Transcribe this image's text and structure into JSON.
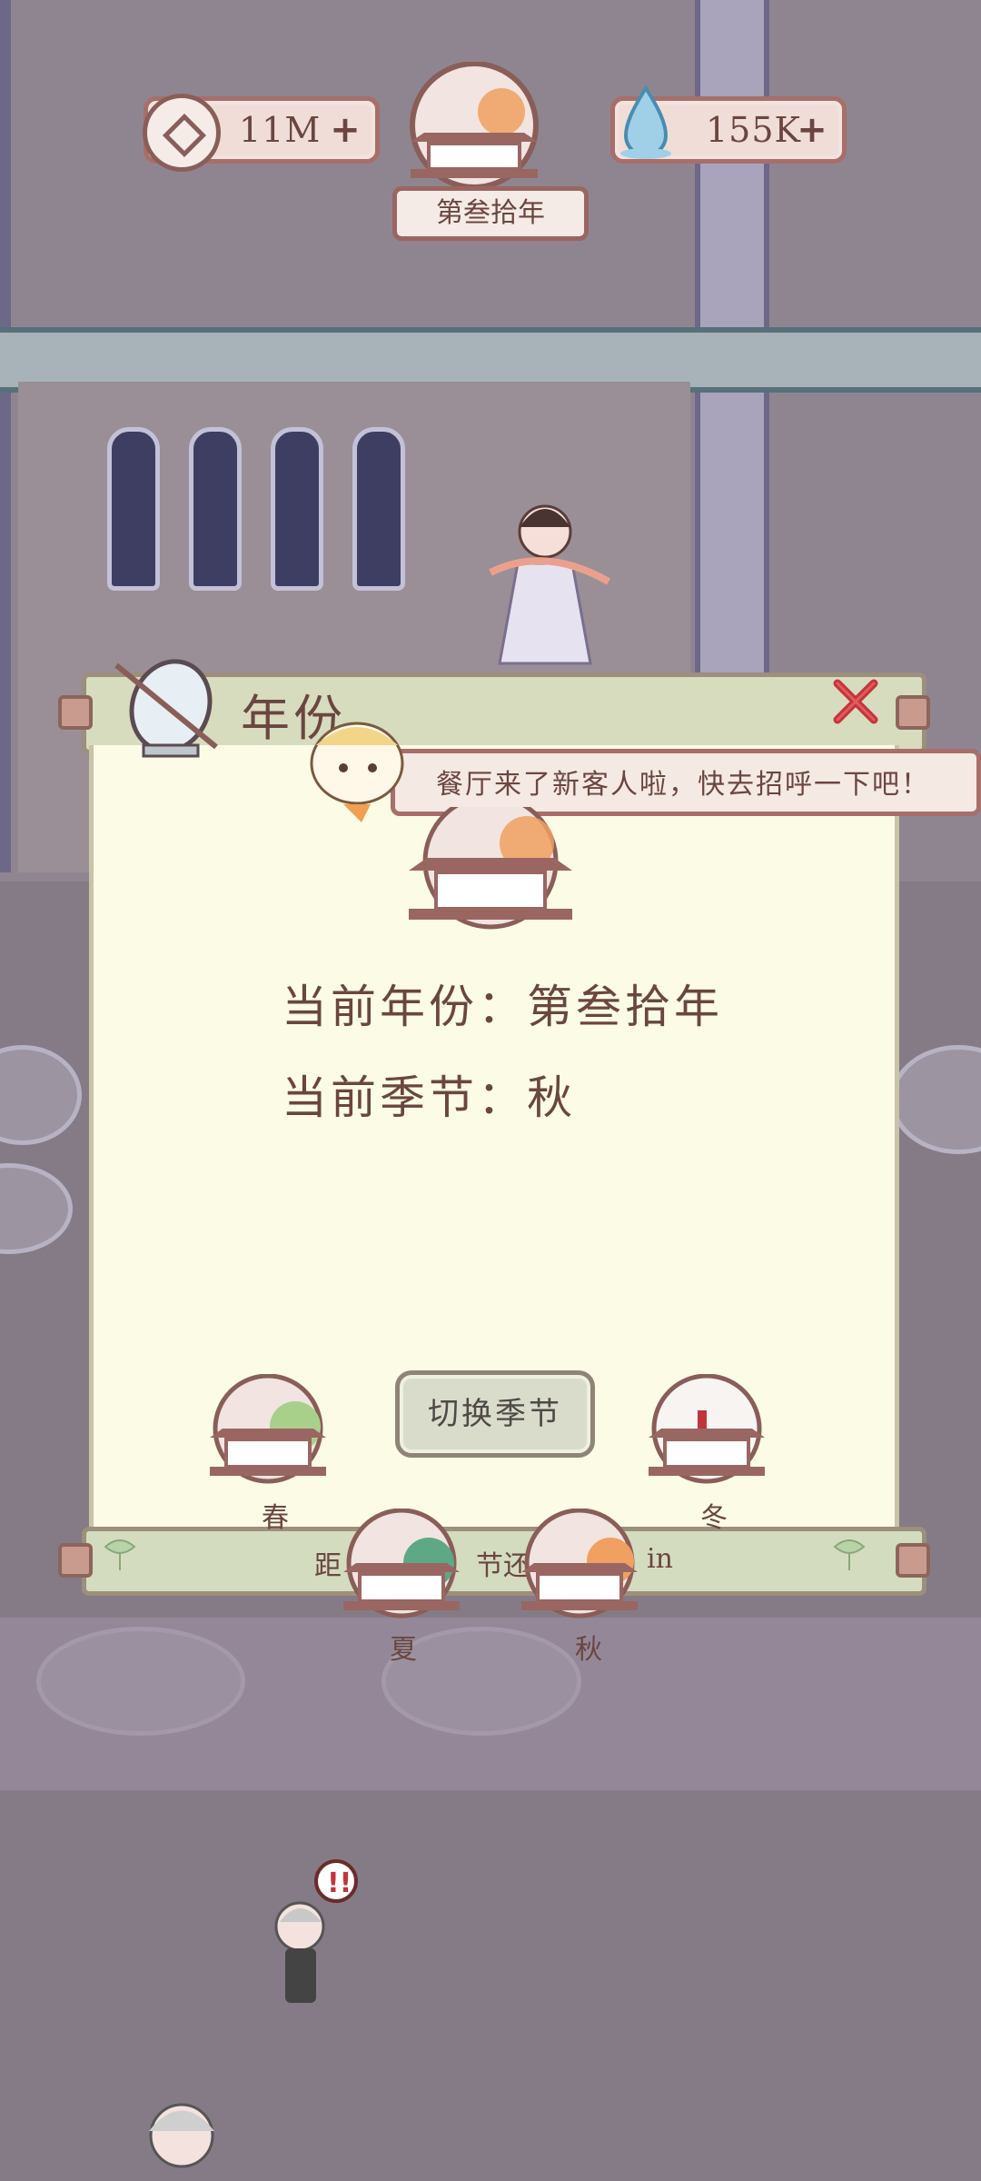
{
  "hud": {
    "currency": {
      "icon": "copper-coin-icon",
      "value": "11M"
    },
    "spirit": {
      "icon": "water-drop-icon",
      "value": "155K"
    },
    "year_banner": "第叁拾年"
  },
  "dialog": {
    "title": "年份",
    "toast": "餐厅来了新客人啦，快去招呼一下吧！",
    "current_year": "当前年份：第叁拾年",
    "current_season": "当前季节：秋",
    "switch_button": "切换季节",
    "seasons": [
      {
        "label": "春",
        "tree_color": "#a8d08a"
      },
      {
        "label": "夏",
        "tree_color": "#5fa886"
      },
      {
        "label": "秋",
        "tree_color": "#f0a060"
      },
      {
        "label": "冬",
        "tree_color": "#ffffff"
      }
    ],
    "footer_left": "距",
    "footer_mid": "节还",
    "footer_right": "in"
  },
  "colors": {
    "text": "#6b4640",
    "paper": "#fbfbe6",
    "scroll_trim": "#d7dcbf",
    "close": "#c2353a"
  }
}
